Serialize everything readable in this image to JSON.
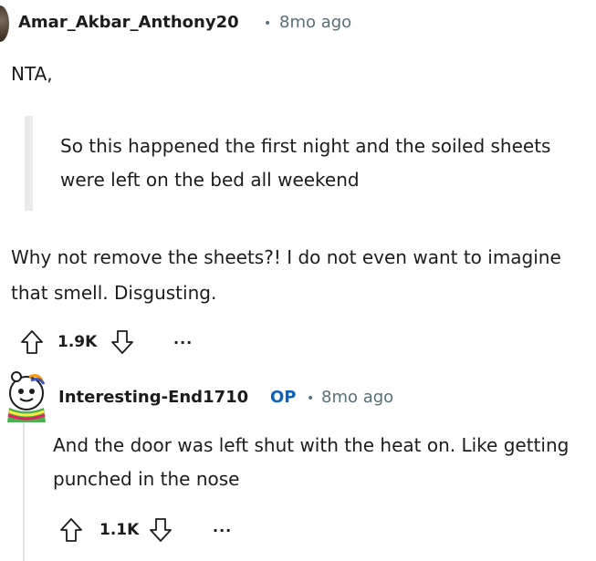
{
  "comment1": {
    "username": "Amar_Akbar_Anthony20",
    "separator": "•",
    "time": "8mo ago",
    "line1": "NTA,",
    "quote": "So this happened the first night and the soiled sheets were left on the bed all weekend",
    "text": "Why not remove the sheets?! I do not even want to imagine that smell. Disgusting.",
    "votes": "1.9K",
    "more": "..."
  },
  "comment2": {
    "username": "Interesting-End1710",
    "op_badge": "OP",
    "separator": "•",
    "time": "8mo ago",
    "text": "And the door was left shut with the heat on. Like getting punched in the nose",
    "votes": "1.1K",
    "more": "..."
  },
  "icons": {
    "upvote": "upvote-arrow-icon",
    "downvote": "downvote-arrow-icon",
    "more": "more-options-icon",
    "avatar": "user-avatar"
  },
  "colors": {
    "text": "#1c1c1c",
    "meta": "#576f76",
    "op": "#0a63b8",
    "quote_bar": "#eaeaea"
  }
}
